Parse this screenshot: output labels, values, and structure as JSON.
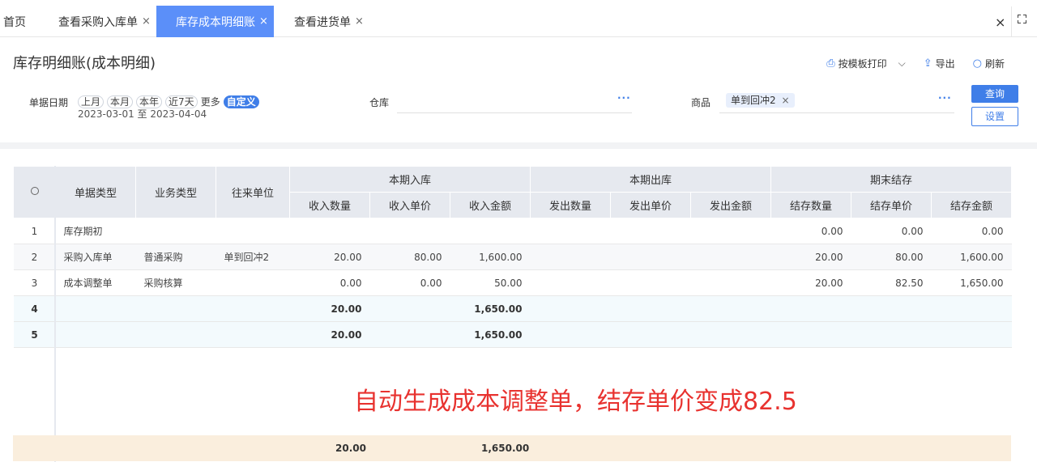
{
  "tabs": [
    {
      "label": "首页",
      "closable": false,
      "active": false
    },
    {
      "label": "查看采购入库单",
      "closable": true,
      "active": false
    },
    {
      "label": "库存成本明细账",
      "closable": true,
      "active": true
    },
    {
      "label": "查看进货单",
      "closable": true,
      "active": false
    }
  ],
  "tab_close_glyph": "×",
  "header": {
    "title": "库存明细账(成本明细)",
    "actions": {
      "print": "按模板打印",
      "export": "导出",
      "refresh": "刷新"
    }
  },
  "filter": {
    "date_label": "单据日期",
    "quick": [
      "上月",
      "本月",
      "本年",
      "近7天",
      "更多",
      "自定义"
    ],
    "date_range": "2023-03-01 至 2023-04-04",
    "warehouse_label": "仓库",
    "warehouse_value": "",
    "product_label": "商品",
    "product_tag": "单到回冲2",
    "more_glyph": "···",
    "query_button": "查询",
    "settings_button": "设置"
  },
  "table": {
    "headers": {
      "doc_type": "单据类型",
      "biz_type": "业务类型",
      "partner": "往来单位",
      "in_group": "本期入库",
      "out_group": "本期出库",
      "end_group": "期末结存",
      "in": [
        "收入数量",
        "收入单价",
        "收入金额"
      ],
      "out": [
        "发出数量",
        "发出单价",
        "发出金额"
      ],
      "end": [
        "结存数量",
        "结存单价",
        "结存金额"
      ]
    },
    "rows": [
      {
        "idx": "1",
        "doc_type": "库存期初",
        "biz_type": "",
        "partner": "",
        "in_qty": "",
        "in_price": "",
        "in_amt": "",
        "out_qty": "",
        "out_price": "",
        "out_amt": "",
        "end_qty": "0.00",
        "end_price": "0.00",
        "end_amt": "0.00"
      },
      {
        "idx": "2",
        "doc_type": "采购入库单",
        "biz_type": "普通采购",
        "partner": "单到回冲2",
        "in_qty": "20.00",
        "in_price": "80.00",
        "in_amt": "1,600.00",
        "out_qty": "",
        "out_price": "",
        "out_amt": "",
        "end_qty": "20.00",
        "end_price": "80.00",
        "end_amt": "1,600.00"
      },
      {
        "idx": "3",
        "doc_type": "成本调整单",
        "biz_type": "采购核算",
        "partner": "",
        "in_qty": "0.00",
        "in_price": "0.00",
        "in_amt": "50.00",
        "out_qty": "",
        "out_price": "",
        "out_amt": "",
        "end_qty": "20.00",
        "end_price": "82.50",
        "end_amt": "1,650.00"
      },
      {
        "idx": "4",
        "doc_type": "",
        "biz_type": "",
        "partner": "",
        "in_qty": "20.00",
        "in_price": "",
        "in_amt": "1,650.00",
        "out_qty": "",
        "out_price": "",
        "out_amt": "",
        "end_qty": "",
        "end_price": "",
        "end_amt": ""
      },
      {
        "idx": "5",
        "doc_type": "",
        "biz_type": "",
        "partner": "",
        "in_qty": "20.00",
        "in_price": "",
        "in_amt": "1,650.00",
        "out_qty": "",
        "out_price": "",
        "out_amt": "",
        "end_qty": "",
        "end_price": "",
        "end_amt": ""
      }
    ],
    "footer": {
      "in_qty": "20.00",
      "in_amt": "1,650.00"
    }
  },
  "annotation": "自动生成成本调整单，结存单价变成82.5",
  "colors": {
    "accent": "#3f7ee8",
    "active_tab": "#5b8ff9",
    "annotation": "#e8322f",
    "footer_bg": "#faeedd",
    "summary_bg": "#f3fafd"
  }
}
